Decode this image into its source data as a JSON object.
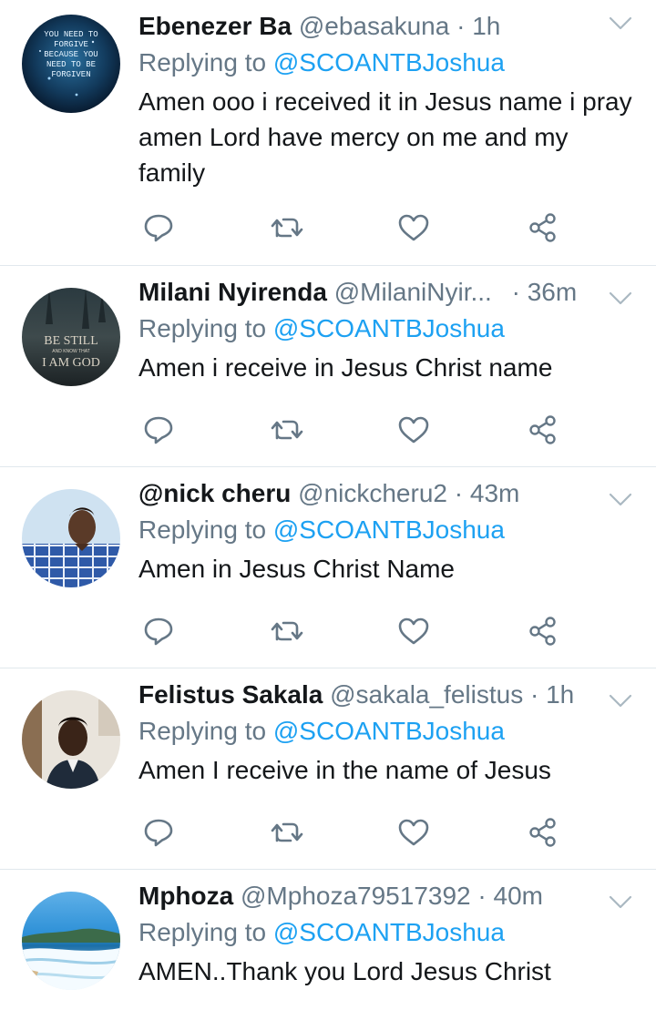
{
  "colors": {
    "link": "#1da1f2",
    "muted": "#657786",
    "text": "#14171a",
    "divider": "#e1e8ed"
  },
  "icons": {
    "reply": "reply-icon",
    "retweet": "retweet-icon",
    "like": "heart-icon",
    "share": "share-icon",
    "menu": "chevron-down-icon"
  },
  "tweets": [
    {
      "name": "Ebenezer Ba",
      "handle": "@ebasakuna",
      "dot": "·",
      "time": "1h",
      "replying_prefix": "Replying to",
      "replying_to": "@SCOANTBJoshua",
      "text": "Amen ooo i received it in Jesus name i pray amen  Lord have mercy on me and my family",
      "avatar_text": [
        "YOU NEED TO",
        "FORGIVE",
        "BECAUSE YOU",
        "NEED TO BE",
        "FORGIVEN"
      ]
    },
    {
      "name": "Milani Nyirenda",
      "handle": "@MilaniNyir...",
      "dot": "·",
      "time": "36m",
      "replying_prefix": "Replying to",
      "replying_to": "@SCOANTBJoshua",
      "text": "Amen i receive in Jesus Christ name",
      "avatar_text": [
        "BE STILL",
        "AND KNOW THAT",
        "I AM GOD"
      ]
    },
    {
      "name": "@nick cheru",
      "handle": "@nickcheru2",
      "dot": "·",
      "time": "43m",
      "replying_prefix": "Replying to",
      "replying_to": "@SCOANTBJoshua",
      "text": "Amen in Jesus Christ Name"
    },
    {
      "name": "Felistus Sakala",
      "handle": "@sakala_felistus",
      "dot": "·",
      "time": "1h",
      "replying_prefix": "Replying to",
      "replying_to": "@SCOANTBJoshua",
      "text": "Amen I receive in the name of Jesus"
    },
    {
      "name": "Mphoza",
      "handle": "@Mphoza79517392",
      "dot": "·",
      "time": "40m",
      "replying_prefix": "Replying to",
      "replying_to": "@SCOANTBJoshua",
      "text": "AMEN..Thank you Lord Jesus Christ"
    }
  ]
}
